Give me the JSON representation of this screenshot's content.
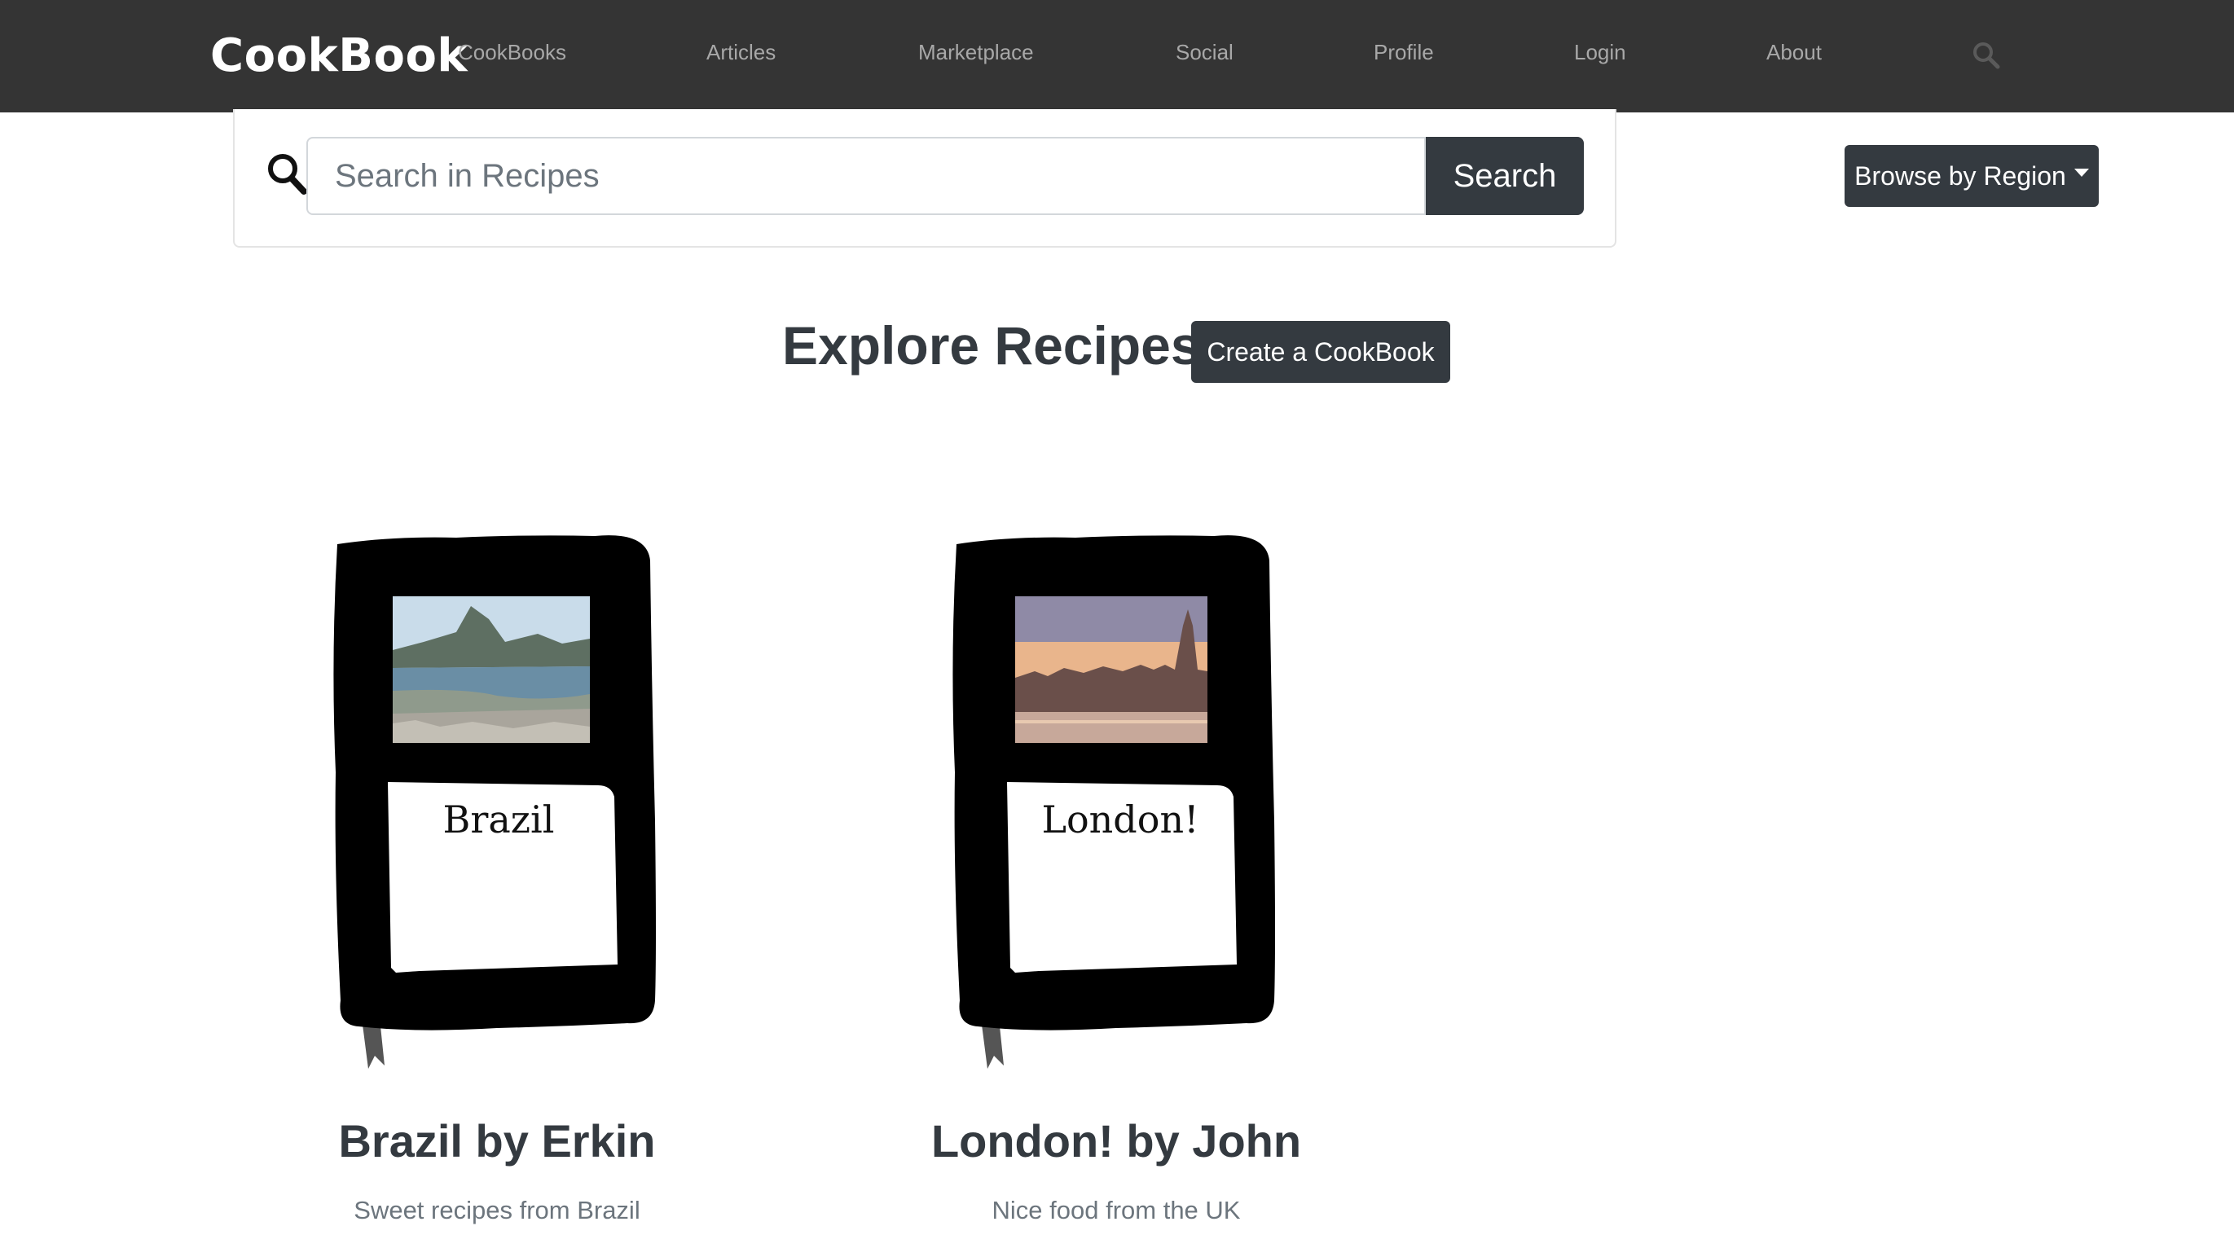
{
  "navbar": {
    "brand": "CookBook",
    "links": [
      "CookBooks",
      "Articles",
      "Marketplace",
      "Social",
      "Profile",
      "Login",
      "About"
    ],
    "icon": "search-icon"
  },
  "search": {
    "placeholder": "Search in Recipes",
    "value": "",
    "button_label": "Search",
    "icon": "search-icon"
  },
  "region_dropdown": {
    "label": "Browse by Region",
    "icon": "caret-down-icon"
  },
  "main": {
    "title": "Explore Recipes",
    "create_label": "Create a CookBook"
  },
  "cookbooks": [
    {
      "cover_label": "Brazil",
      "title": "Brazil by Erkin",
      "description": "Sweet recipes from Brazil",
      "photo": "rio-de-janeiro-bay-photo"
    },
    {
      "cover_label": "London!",
      "title": "London! by John",
      "description": "Nice food from the UK",
      "photo": "london-parliament-photo"
    }
  ],
  "colors": {
    "navbar_bg": "#343434",
    "button_dark": "#343a40",
    "nav_link": "#a8a8a8",
    "muted_text": "#6c757d"
  }
}
